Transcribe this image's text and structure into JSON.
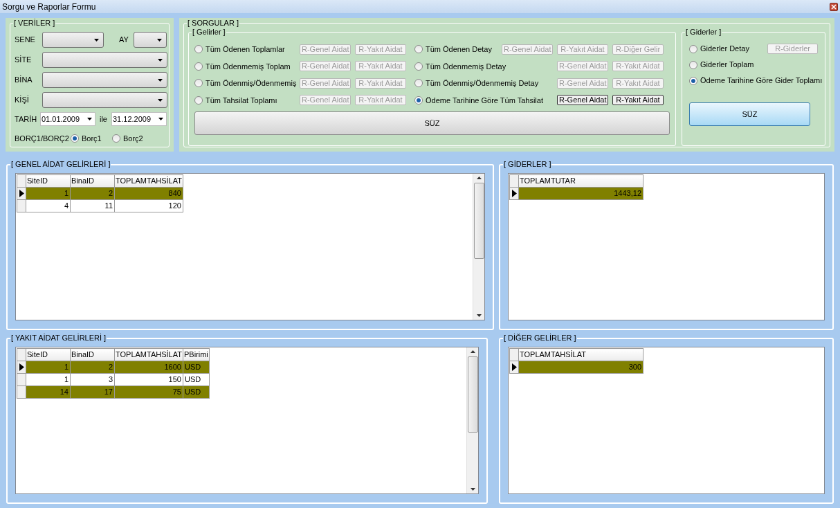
{
  "window": {
    "title": "Sorgu ve Raporlar Formu"
  },
  "veriler": {
    "title": "[ VERİLER ]",
    "sene": {
      "label": "SENE"
    },
    "ay": {
      "label": "AY"
    },
    "site": {
      "label": "SİTE"
    },
    "bina": {
      "label": "BİNA"
    },
    "kisi": {
      "label": "KİŞİ"
    },
    "tarih": {
      "label": "TARİH",
      "from": "01.01.2009",
      "joiner": "ile",
      "to": "31.12.2009"
    },
    "borc": {
      "label": "BORÇ1/BORÇ2",
      "options": [
        {
          "label": "Borç1",
          "selected": true
        },
        {
          "label": "Borç2",
          "selected": false
        }
      ]
    }
  },
  "sorgular": {
    "title": "[ SORGULAR ]",
    "gelirler": {
      "title": "[ Gelirler ]",
      "options": [
        {
          "label": "Tüm Ödenen Toplamlar",
          "selected": false,
          "buttons": [
            {
              "label": "R-Genel Aidat",
              "enabled": false
            },
            {
              "label": "R-Yakıt Aidat",
              "enabled": false
            }
          ]
        },
        {
          "label": "Tüm Ödenen Detay",
          "selected": false,
          "buttons": [
            {
              "label": "R-Genel Aidat",
              "enabled": false
            },
            {
              "label": "R-Yakıt Aidat",
              "enabled": false
            },
            {
              "label": "R-Diğer Gelir",
              "enabled": false
            }
          ]
        },
        {
          "label": "Tüm Ödenmemiş Toplam",
          "selected": false,
          "buttons": [
            {
              "label": "R-Genel Aidat",
              "enabled": false
            },
            {
              "label": "R-Yakıt Aidat",
              "enabled": false
            }
          ]
        },
        {
          "label": "Tüm Ödenmemiş Detay",
          "selected": false,
          "buttons": [
            {
              "label": "R-Genel Aidat",
              "enabled": false
            },
            {
              "label": "R-Yakıt Aidat",
              "enabled": false
            }
          ]
        },
        {
          "label": "Tüm Ödenmiş/Ödenmemiş",
          "selected": false,
          "buttons": [
            {
              "label": "R-Genel Aidat",
              "enabled": false
            },
            {
              "label": "R-Yakıt Aidat",
              "enabled": false
            }
          ]
        },
        {
          "label": "Tüm Ödenmiş/Ödenmemiş Detay",
          "selected": false,
          "buttons": [
            {
              "label": "R-Genel Aidat",
              "enabled": false
            },
            {
              "label": "R-Yakıt Aidat",
              "enabled": false
            }
          ]
        },
        {
          "label": "Tüm Tahsilat Toplamı",
          "selected": false,
          "buttons": [
            {
              "label": "R-Genel Aidat",
              "enabled": false
            },
            {
              "label": "R-Yakıt Aidat",
              "enabled": false
            }
          ]
        },
        {
          "label": "Ödeme Tarihine Göre Tüm Tahsilat",
          "selected": true,
          "buttons": [
            {
              "label": "R-Genel Aidat",
              "enabled": true
            },
            {
              "label": "R-Yakıt Aidat",
              "enabled": true
            }
          ]
        }
      ],
      "button": "SÜZ"
    },
    "giderler": {
      "title": "[ Giderler ]",
      "options": [
        {
          "label": "Giderler Detay",
          "selected": false,
          "buttons": [
            {
              "label": "R-Giderler",
              "enabled": false
            }
          ]
        },
        {
          "label": "Giderler Toplam",
          "selected": false
        },
        {
          "label": "Ödeme Tarihine Göre Gider Toplamı",
          "selected": true
        }
      ],
      "button": "SÜZ"
    }
  },
  "grids": [
    {
      "title": "[ GENEL AİDAT GELİRLERİ ]",
      "has_scrollbar": true,
      "columns": [
        {
          "label": "SiteID",
          "kind": "number"
        },
        {
          "label": "BinaID",
          "kind": "number"
        },
        {
          "label": "TOPLAMTAHSİLAT",
          "kind": "number"
        }
      ],
      "rows": [
        {
          "cells": [
            "1",
            "2",
            "840"
          ],
          "highlighted": true,
          "current": true
        },
        {
          "cells": [
            "4",
            "11",
            "120"
          ],
          "highlighted": false,
          "current": false
        }
      ]
    },
    {
      "title": "[ GİDERLER ]",
      "has_scrollbar": false,
      "columns": [
        {
          "label": "TOPLAMTUTAR",
          "kind": "number"
        }
      ],
      "rows": [
        {
          "cells": [
            "1443,12"
          ],
          "highlighted": true,
          "current": true
        }
      ]
    },
    {
      "title": "[ YAKIT AİDAT GELİRLERİ ]",
      "has_scrollbar": true,
      "columns": [
        {
          "label": "SiteID",
          "kind": "number"
        },
        {
          "label": "BinaID",
          "kind": "number"
        },
        {
          "label": "TOPLAMTAHSİLAT",
          "kind": "number"
        },
        {
          "label": "PBirimi",
          "kind": "text"
        }
      ],
      "rows": [
        {
          "cells": [
            "1",
            "2",
            "1600",
            "USD"
          ],
          "highlighted": true,
          "current": true
        },
        {
          "cells": [
            "1",
            "3",
            "150",
            "USD"
          ],
          "highlighted": false,
          "current": false
        },
        {
          "cells": [
            "14",
            "17",
            "75",
            "USD"
          ],
          "highlighted": true,
          "current": false
        }
      ]
    },
    {
      "title": "[ DİĞER GELİRLER ]",
      "has_scrollbar": false,
      "columns": [
        {
          "label": "TOPLAMTAHSİLAT",
          "kind": "number"
        }
      ],
      "rows": [
        {
          "cells": [
            "300"
          ],
          "highlighted": true,
          "current": true
        }
      ]
    }
  ]
}
